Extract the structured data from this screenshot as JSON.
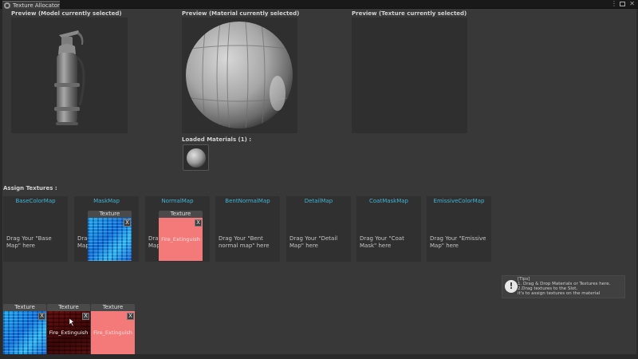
{
  "window": {
    "tab_title": "Texture Allocator",
    "menu_glyph": "⋮",
    "close_glyph": "✕"
  },
  "previews": {
    "model_label": "Preview (Model currently selected)",
    "material_label": "Preview (Material currently selected)",
    "texture_label": "Preview (Texture currently selected)"
  },
  "materials": {
    "loaded_label": "Loaded Materials (1) :"
  },
  "assign": {
    "label": "Assign Textures :",
    "slots": [
      {
        "title": "BaseColorMap",
        "hint": "Drag Your \"Base Map\" here"
      },
      {
        "title": "MaskMap",
        "hint": "Drag Your \"Mask Map\" here"
      },
      {
        "title": "NormalMap",
        "hint": "Drag Your \"Normal Map\" here"
      },
      {
        "title": "BentNormalMap",
        "hint": "Drag Your \"Bent normal map\" here"
      },
      {
        "title": "DetailMap",
        "hint": "Drag Your \"Detail Map\" here"
      },
      {
        "title": "CoatMaskMap",
        "hint": "Drag Your \"Coat Mask\" here"
      },
      {
        "title": "EmissiveColorMap",
        "hint": "Drag Your \"Emissive Map\" here"
      }
    ],
    "assigned": [
      {
        "slot": "MaskMap",
        "header": "Texture",
        "close": "X",
        "name": ""
      },
      {
        "slot": "NormalMap",
        "header": "Texture",
        "close": "X",
        "name": "Fire_Extinguish"
      }
    ]
  },
  "tips": {
    "title": "[Tips]",
    "line1": "1. Drag & Drop Materials or Textures here.",
    "line2": "2.Drag textures to the Slot,",
    "line3": "   it's to assign textures on the material",
    "icon": "!"
  },
  "loaded_textures": [
    {
      "header": "Texture",
      "close": "X",
      "name": "",
      "kind": "blue"
    },
    {
      "header": "Texture",
      "close": "X",
      "name": "Fire_Extinguish",
      "kind": "red"
    },
    {
      "header": "Texture",
      "close": "X",
      "name": "Fire_Extinguish",
      "kind": "pink"
    }
  ],
  "colors": {
    "slot_title": "#3fb4d4",
    "panel_bg": "#383838",
    "preview_bg": "#2f2f2f",
    "normal_map_pink": "#f47a7a"
  }
}
